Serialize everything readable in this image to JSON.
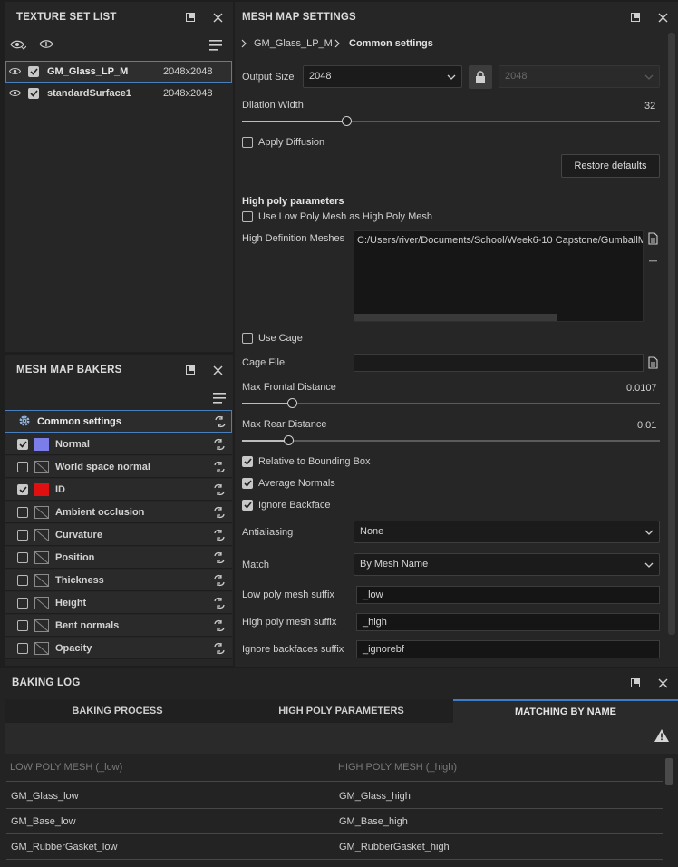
{
  "texture_set_list": {
    "title": "TEXTURE SET LIST",
    "items": [
      {
        "name": "GM_Glass_LP_M",
        "size": "2048x2048",
        "selected": true
      },
      {
        "name": "standardSurface1",
        "size": "2048x2048",
        "selected": false
      }
    ]
  },
  "mesh_map_bakers": {
    "title": "MESH MAP BAKERS",
    "common": "Common settings",
    "bakers": [
      {
        "label": "Normal",
        "checked": true,
        "swatch": "#7b7de8"
      },
      {
        "label": "World space normal",
        "checked": false,
        "swatch": null
      },
      {
        "label": "ID",
        "checked": true,
        "swatch": "#e01010"
      },
      {
        "label": "Ambient occlusion",
        "checked": false,
        "swatch": null
      },
      {
        "label": "Curvature",
        "checked": false,
        "swatch": null
      },
      {
        "label": "Position",
        "checked": false,
        "swatch": null
      },
      {
        "label": "Thickness",
        "checked": false,
        "swatch": null
      },
      {
        "label": "Height",
        "checked": false,
        "swatch": null
      },
      {
        "label": "Bent normals",
        "checked": false,
        "swatch": null
      },
      {
        "label": "Opacity",
        "checked": false,
        "swatch": null
      }
    ]
  },
  "mesh_map_settings": {
    "title": "MESH MAP SETTINGS",
    "breadcrumb": {
      "root": "GM_Glass_LP_M",
      "current": "Common settings"
    },
    "output_size": {
      "label": "Output Size",
      "value": "2048",
      "linked_value": "2048"
    },
    "dilation": {
      "label": "Dilation Width",
      "value": "32",
      "fraction": 0.25
    },
    "apply_diffusion": {
      "label": "Apply Diffusion",
      "checked": false
    },
    "restore_defaults": "Restore defaults",
    "high_poly_title": "High poly parameters",
    "use_low_poly": {
      "label": "Use Low Poly Mesh as High Poly Mesh",
      "checked": false
    },
    "hd_meshes": {
      "label": "High Definition Meshes",
      "value": "C:/Users/river/Documents/School/Week6-10 Capstone/GumballM"
    },
    "use_cage": {
      "label": "Use Cage",
      "checked": false
    },
    "cage_file": {
      "label": "Cage File",
      "value": ""
    },
    "max_frontal": {
      "label": "Max Frontal Distance",
      "value": "0.0107",
      "fraction": 0.12
    },
    "max_rear": {
      "label": "Max Rear Distance",
      "value": "0.01",
      "fraction": 0.11
    },
    "relative_bbox": {
      "label": "Relative to Bounding Box",
      "checked": true
    },
    "average_normals": {
      "label": "Average Normals",
      "checked": true
    },
    "ignore_backface": {
      "label": "Ignore Backface",
      "checked": true
    },
    "antialiasing": {
      "label": "Antialiasing",
      "value": "None"
    },
    "match": {
      "label": "Match",
      "value": "By Mesh Name"
    },
    "low_suffix": {
      "label": "Low poly mesh suffix",
      "value": "_low"
    },
    "high_suffix": {
      "label": "High poly mesh suffix",
      "value": "_high"
    },
    "ignore_suffix": {
      "label": "Ignore backfaces suffix",
      "value": "_ignorebf"
    }
  },
  "baking_log": {
    "title": "BAKING LOG",
    "tabs": [
      "BAKING PROCESS",
      "HIGH POLY PARAMETERS",
      "MATCHING BY NAME"
    ],
    "active_tab": 2,
    "columns": [
      "LOW POLY MESH (_low)",
      "HIGH POLY MESH (_high)"
    ],
    "rows": [
      [
        "GM_Glass_low",
        "GM_Glass_high"
      ],
      [
        "GM_Base_low",
        "GM_Base_high"
      ],
      [
        "GM_RubberGasket_low",
        "GM_RubberGasket_high"
      ]
    ]
  },
  "colors": {
    "accent": "#3d7cc9",
    "panel": "#262626",
    "background": "#1e1e1e"
  }
}
